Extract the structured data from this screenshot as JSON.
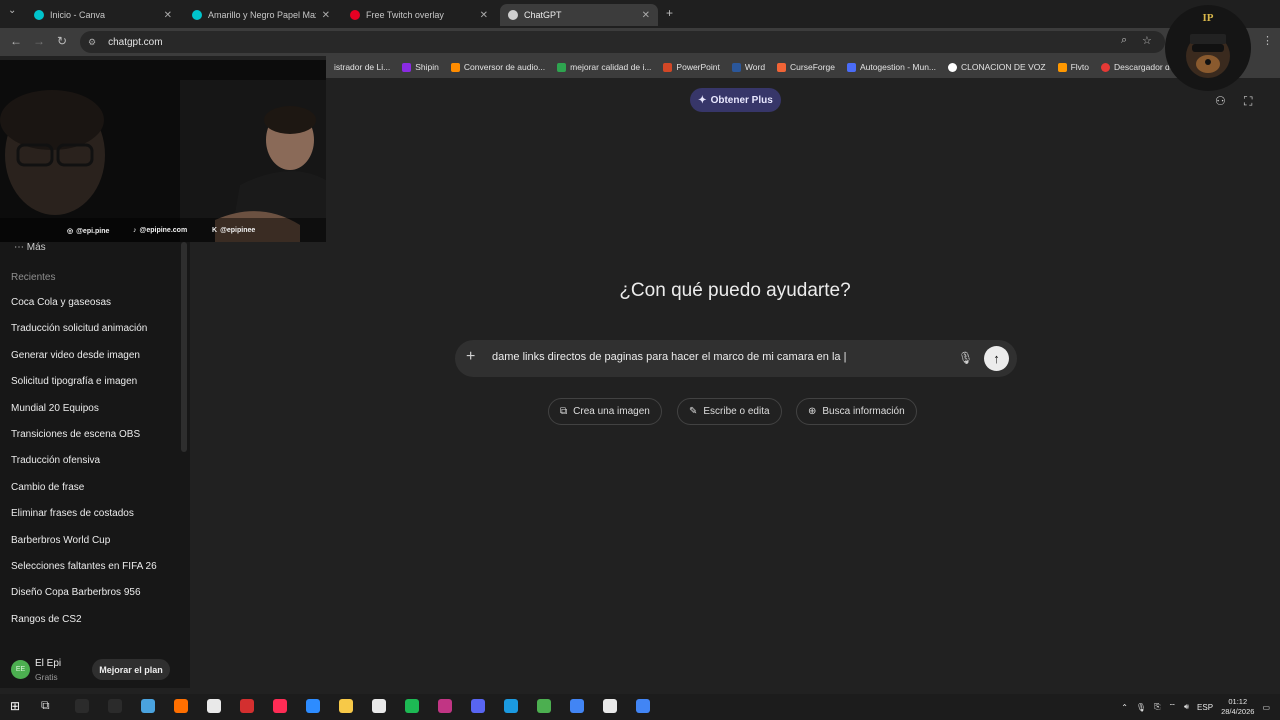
{
  "browser": {
    "tabs": [
      {
        "label": "Inicio - Canva",
        "color": "#00c4cc"
      },
      {
        "label": "Amarillo y Negro Papel Maxima",
        "color": "#00c4cc"
      },
      {
        "label": "Free Twitch overlay",
        "color": "#e60023"
      },
      {
        "label": "ChatGPT",
        "color": "#cfcfcf"
      }
    ],
    "url": "chatgpt.com",
    "bookmarks": [
      {
        "label": "istrador de Li...",
        "color": "#0a66c2"
      },
      {
        "label": "Shipin",
        "color": "#8a2be2"
      },
      {
        "label": "Conversor de audio...",
        "color": "#ff8c00"
      },
      {
        "label": "mejorar calidad de i...",
        "color": "#2ea44f"
      },
      {
        "label": "PowerPoint",
        "color": "#d24726"
      },
      {
        "label": "Word",
        "color": "#2b579a"
      },
      {
        "label": "CurseForge",
        "color": "#f16436"
      },
      {
        "label": "Autogestion - Mun...",
        "color": "#4a6cf7"
      },
      {
        "label": "CLONACION DE VOZ",
        "color": "#ffffff"
      },
      {
        "label": "Flvto",
        "color": "#ff9800"
      },
      {
        "label": "Descargador de Vid...",
        "color": "#e53935"
      }
    ]
  },
  "webcam": {
    "socials": [
      "@epi.pine",
      "@epipine.com",
      "@epipinee"
    ]
  },
  "sidebar": {
    "more_label": "Más",
    "section_title": "Recientes",
    "chats": [
      "Coca Cola y gaseosas",
      "Traducción solicitud animación",
      "Generar video desde imagen",
      "Solicitud tipografía e imagen",
      "Mundial 20 Equipos",
      "Transiciones de escena OBS",
      "Traducción ofensiva",
      "Cambio de frase",
      "Eliminar frases de costados",
      "Barberbros World Cup",
      "Selecciones faltantes en FIFA 26",
      "Diseño Copa Barberbros 956",
      "Rangos de CS2"
    ],
    "user": {
      "initials": "EE",
      "name": "El Epi",
      "plan": "Gratis",
      "upgrade_label": "Mejorar el plan"
    }
  },
  "main": {
    "get_plus_label": "Obtener Plus",
    "hero": "¿Con qué puedo ayudarte?",
    "prompt_value": "dame links directos de paginas para hacer el marco de mi camara en la |",
    "chips": [
      "Crea una imagen",
      "Escribe o edita",
      "Busca información"
    ]
  },
  "badge": {
    "text": "IP"
  },
  "taskbar": {
    "language": "ESP",
    "time": "01:12",
    "date": "28/4/2026",
    "app_colors": [
      "#2b2b2b",
      "#2b2b2b",
      "#4aa3df",
      "#ff6f00",
      "#e9e9e9",
      "#d32f2f",
      "#fe2c55",
      "#2d8cff",
      "#f7c948",
      "#e9e9e9",
      "#1db954",
      "#c13584",
      "#5865f2",
      "#1b9ae0",
      "#4caf50",
      "#4285f4",
      "#e9e9e9",
      "#4285f4"
    ]
  }
}
